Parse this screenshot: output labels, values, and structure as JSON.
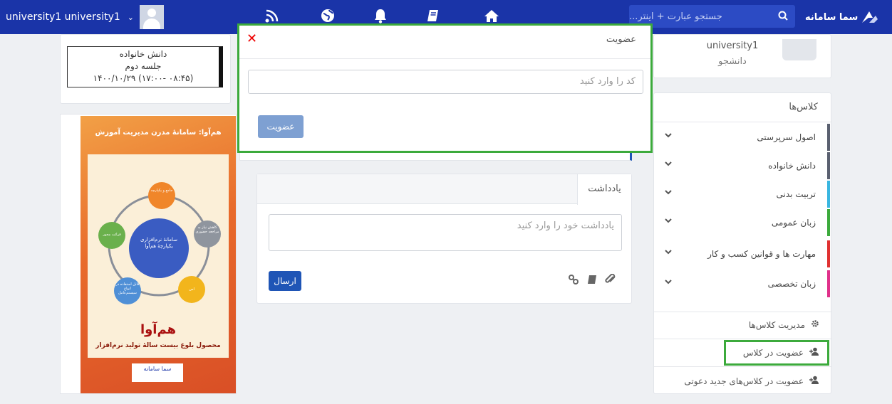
{
  "topbar": {
    "username": "university1 university1",
    "search_placeholder": "جستجو عبارت + اینتر...",
    "logo_text": "سما سامانه",
    "nav_icons": [
      "rss-icon",
      "globe-icon",
      "bell-icon",
      "book-icon",
      "home-icon"
    ]
  },
  "session": {
    "class_name": "دانش خانواده",
    "session_name": "جلسه دوم",
    "datetime": "۱۴۰۰/۱۰/۲۹ (۱۷:۰۰- ۰۸:۴۵)"
  },
  "profile": {
    "name": "university1",
    "role": "دانشجو"
  },
  "poster": {
    "banner": "هم‌آوا: سامانهٔ مدرن مدیریت آموزش",
    "center": "سامانهٔ نرم‌افزاری یکپارچهٔ هم‌آوا",
    "nodes": [
      "جامع و یکپارچه",
      "کاهش نیاز به مراجعه حضوری",
      "امن",
      "قابل استفاده در انواع سیستم‌عامل",
      "قرائت محور"
    ],
    "title": "هم‌آوا",
    "subtitle": "محصول بلوغ بیست سالهٔ تولید نرم‌افزار",
    "logo": "سما سامانه"
  },
  "note": {
    "tab_label": "یادداشت",
    "placeholder": "یادداشت خود را وارد کنید",
    "send_label": "ارسال"
  },
  "classes": {
    "title": "کلاس‌ها",
    "items": [
      {
        "label": "اصول سرپرستی",
        "color": "#5a6070"
      },
      {
        "label": "دانش خانواده",
        "color": "#5a6070"
      },
      {
        "label": "تربیت بدنی",
        "color": "#39b6e0"
      },
      {
        "label": "زبان عمومی",
        "color": "#3caa3c"
      },
      {
        "label": "مهارت ها و قوانین کسب و کار",
        "color": "#e03131"
      },
      {
        "label": "زبان تخصصی",
        "color": "#e0308a"
      }
    ],
    "manage_label": "مدیریت کلاس‌ها",
    "join_label": "عضویت در کلاس",
    "join_invited_label": "عضویت در کلاس‌های جدید دعوتی"
  },
  "modal": {
    "title": "عضویت",
    "code_placeholder": "کد را وارد کنید",
    "submit_label": "عضویت"
  },
  "colors": {
    "topbar": "#1a34a8",
    "primary_button": "#1f55b6",
    "highlight": "#3caa3c",
    "close": "#e00000"
  }
}
